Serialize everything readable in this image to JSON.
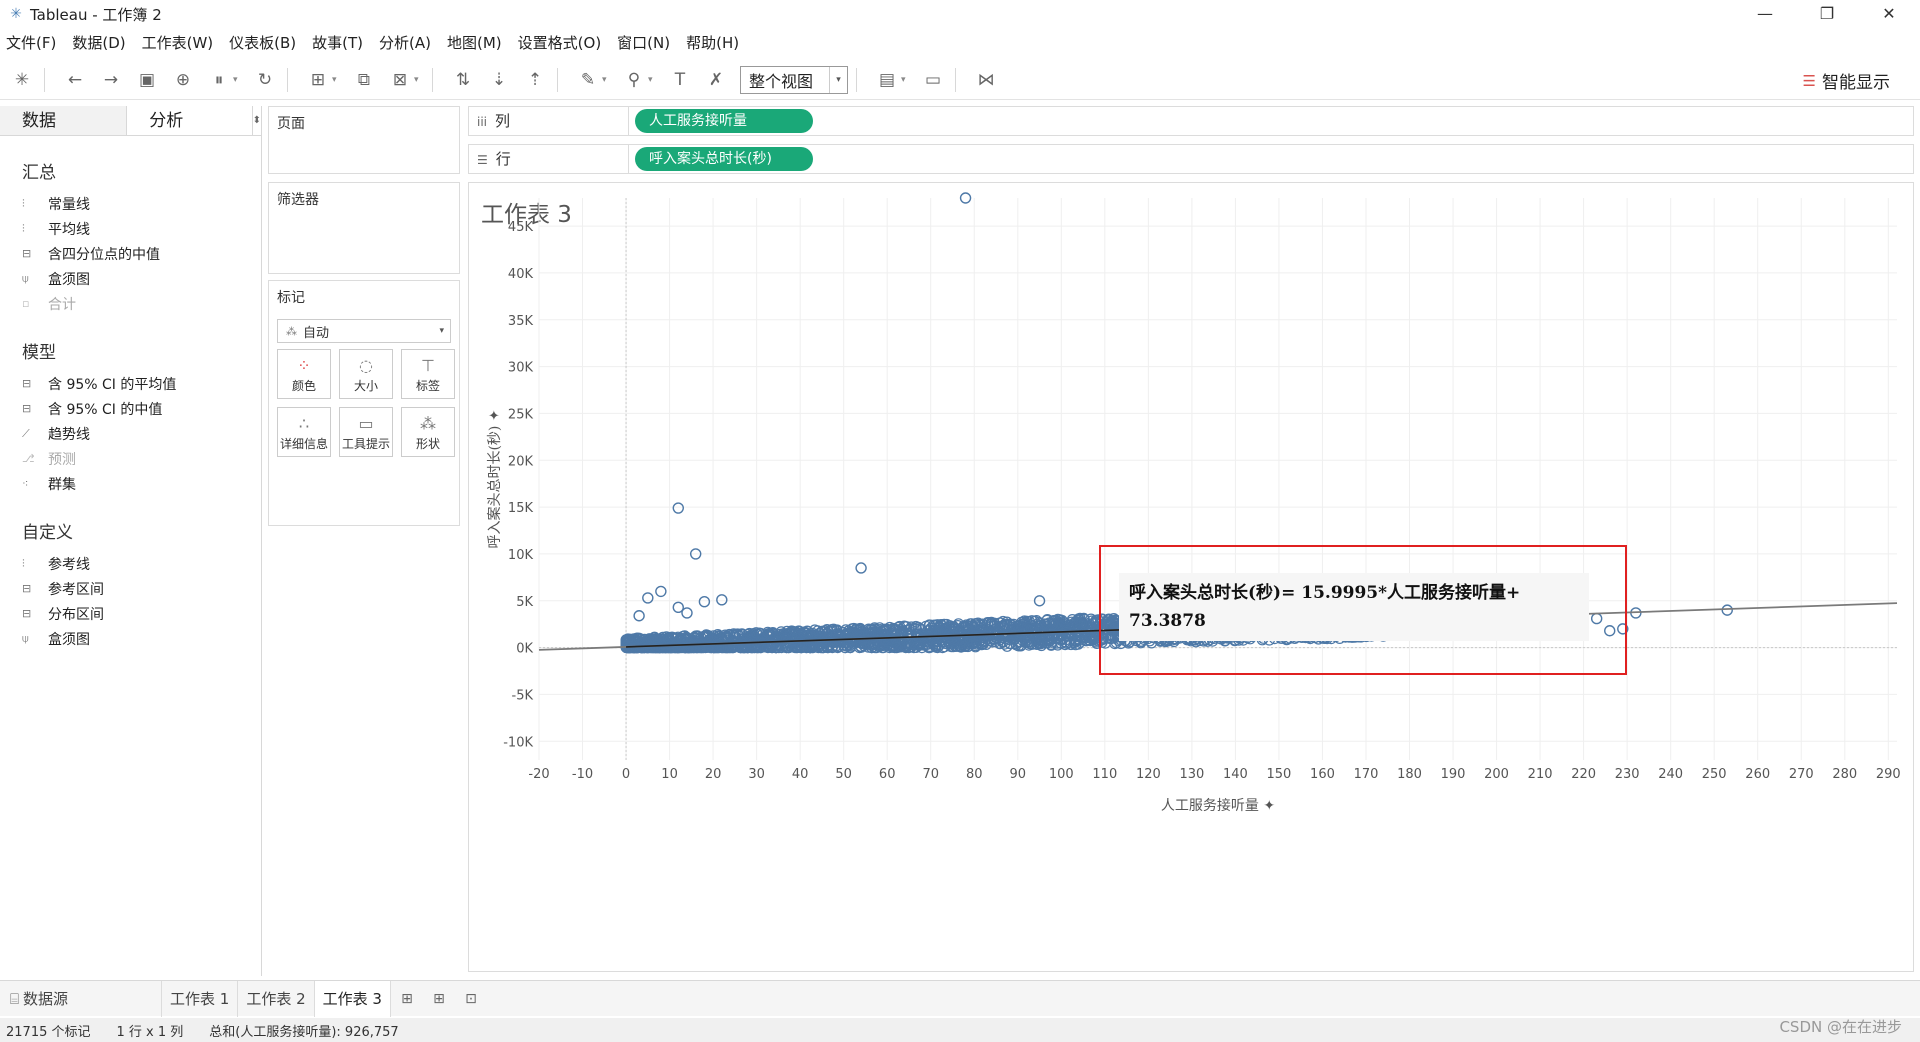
{
  "window": {
    "title": "Tableau - 工作簿 2",
    "controls": [
      "—",
      "❐",
      "✕"
    ]
  },
  "menu": [
    "文件(F)",
    "数据(D)",
    "工作表(W)",
    "仪表板(B)",
    "故事(T)",
    "分析(A)",
    "地图(M)",
    "设置格式(O)",
    "窗口(N)",
    "帮助(H)"
  ],
  "toolbar": {
    "view_fit": "整个视图",
    "smart_show": "智能显示"
  },
  "left_pane": {
    "tabs": [
      "数据",
      "分析"
    ],
    "sections": [
      {
        "title": "汇总",
        "items": [
          {
            "label": "常量线",
            "icon": "line-icon",
            "enabled": true
          },
          {
            "label": "平均线",
            "icon": "line-icon",
            "enabled": true
          },
          {
            "label": "含四分位点的中值",
            "icon": "box-icon",
            "enabled": true
          },
          {
            "label": "盒须图",
            "icon": "boxplot-icon",
            "enabled": true
          },
          {
            "label": "合计",
            "icon": "total-icon",
            "enabled": false
          }
        ]
      },
      {
        "title": "模型",
        "items": [
          {
            "label": "含 95% CI 的平均值",
            "icon": "box-icon",
            "enabled": true
          },
          {
            "label": "含 95% CI 的中值",
            "icon": "box-icon",
            "enabled": true
          },
          {
            "label": "趋势线",
            "icon": "trend-icon",
            "enabled": true
          },
          {
            "label": "预测",
            "icon": "forecast-icon",
            "enabled": false
          },
          {
            "label": "群集",
            "icon": "cluster-icon",
            "enabled": true
          }
        ]
      },
      {
        "title": "自定义",
        "items": [
          {
            "label": "参考线",
            "icon": "line-icon",
            "enabled": true
          },
          {
            "label": "参考区间",
            "icon": "band-icon",
            "enabled": true
          },
          {
            "label": "分布区间",
            "icon": "band-icon",
            "enabled": true
          },
          {
            "label": "盒须图",
            "icon": "boxplot-icon",
            "enabled": true
          }
        ]
      }
    ]
  },
  "cards": {
    "pages": "页面",
    "filters": "筛选器",
    "marks": "标记",
    "marks_type": "自动",
    "mark_buttons": [
      "颜色",
      "大小",
      "标签",
      "详细信息",
      "工具提示",
      "形状"
    ]
  },
  "shelves": {
    "columns_label": "列",
    "columns_pill": "人工服务接听量",
    "rows_label": "行",
    "rows_pill": "呼入案头总时长(秒)"
  },
  "sheet": {
    "title": "工作表 3",
    "annotation": "呼入案头总时长(秒)= 15.9995*人工服务接听量+ 73.3878"
  },
  "chart_data": {
    "type": "scatter",
    "xlabel": "人工服务接听量",
    "ylabel": "呼入案头总时长(秒)",
    "xlim": [
      -20,
      292
    ],
    "ylim": [
      -12000,
      48000
    ],
    "x_ticks": [
      "-20",
      "-10",
      "0",
      "10",
      "20",
      "30",
      "40",
      "50",
      "60",
      "70",
      "80",
      "90",
      "100",
      "110",
      "120",
      "130",
      "140",
      "150",
      "160",
      "170",
      "180",
      "190",
      "200",
      "210",
      "220",
      "230",
      "240",
      "250",
      "260",
      "270",
      "280",
      "290"
    ],
    "y_ticks": [
      "-10K",
      "-5K",
      "0K",
      "5K",
      "10K",
      "15K",
      "20K",
      "25K",
      "30K",
      "35K",
      "40K",
      "45K"
    ],
    "trend_line": {
      "slope": 15.9995,
      "intercept": 73.3878
    },
    "marker_color": "#4e79a7",
    "outliers": [
      {
        "x": 78,
        "y": 48000
      },
      {
        "x": 12,
        "y": 14900
      },
      {
        "x": 16,
        "y": 10000
      },
      {
        "x": 54,
        "y": 8500
      },
      {
        "x": 8,
        "y": 6000
      },
      {
        "x": 5,
        "y": 5300
      },
      {
        "x": 22,
        "y": 5100
      },
      {
        "x": 18,
        "y": 4900
      },
      {
        "x": 95,
        "y": 5000
      },
      {
        "x": 132,
        "y": 5200
      },
      {
        "x": 175,
        "y": 3800
      },
      {
        "x": 200,
        "y": 4000
      },
      {
        "x": 210,
        "y": 3300
      },
      {
        "x": 214,
        "y": 2500
      },
      {
        "x": 218,
        "y": 1900
      },
      {
        "x": 223,
        "y": 3100
      },
      {
        "x": 226,
        "y": 1800
      },
      {
        "x": 229,
        "y": 2000
      },
      {
        "x": 232,
        "y": 3700
      },
      {
        "x": 253,
        "y": 4000
      },
      {
        "x": 200,
        "y": 1500
      },
      {
        "x": 205,
        "y": 1600
      },
      {
        "x": 190,
        "y": 2100
      },
      {
        "x": 193,
        "y": 3000
      },
      {
        "x": 3,
        "y": 3400
      },
      {
        "x": 12,
        "y": 4300
      },
      {
        "x": 14,
        "y": 3700
      }
    ],
    "status": {
      "marks_count": "21715 个标记",
      "dims": "1 行 x 1 列",
      "sum": "总和(人工服务接听量): 926,757"
    }
  },
  "sheet_tabs": {
    "datasource": "数据源",
    "tabs": [
      "工作表 1",
      "工作表 2",
      "工作表 3"
    ],
    "active": 2
  },
  "watermark": "CSDN @在在进步"
}
